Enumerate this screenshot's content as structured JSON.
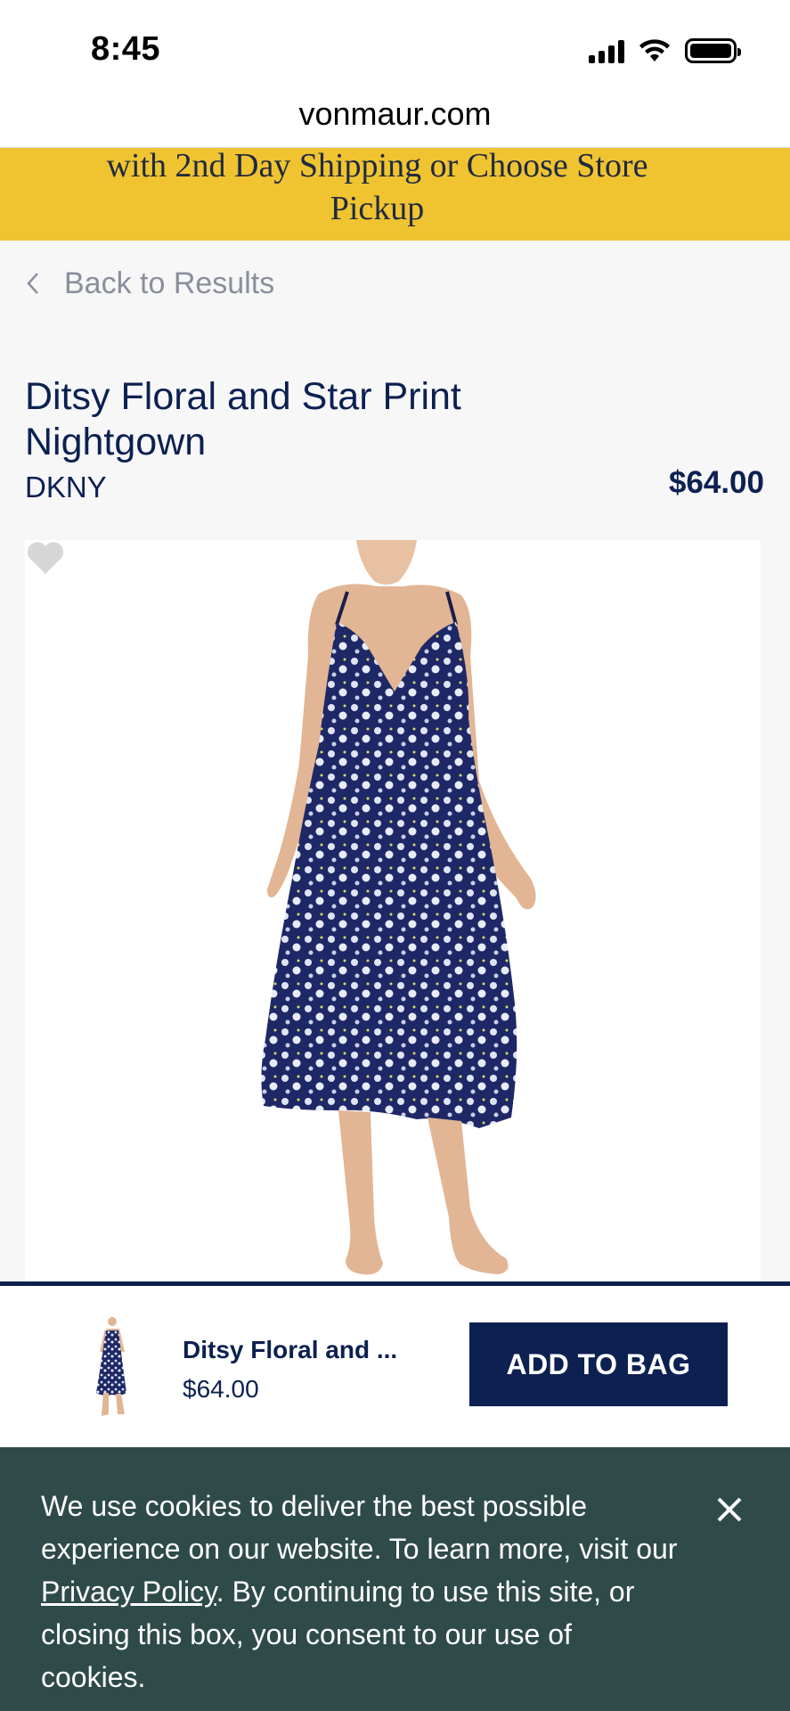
{
  "status_bar": {
    "time": "8:45"
  },
  "browser": {
    "url": "vonmaur.com"
  },
  "promo": {
    "line1": "with 2nd Day Shipping or Choose Store",
    "line2": "Pickup"
  },
  "nav": {
    "back_label": "Back to Results"
  },
  "product": {
    "title_line1": "Ditsy Floral and Star Print",
    "title_line2": "Nightgown",
    "brand": "DKNY",
    "price": "$64.00"
  },
  "sticky_bar": {
    "name": "Ditsy Floral and ...",
    "price": "$64.00",
    "button_label": "ADD TO BAG"
  },
  "cookie": {
    "text_before": "We use cookies to deliver the best possible experience on our website. To learn more, visit our ",
    "link_label": "Privacy Policy",
    "text_after": ". By continuing to use this site, or closing this box, you consent to our use of cookies."
  },
  "colors": {
    "navy": "#0c2051",
    "promo_yellow": "#f0c331",
    "cookie_green": "#2f4b49",
    "page_bg": "#f7f7f8"
  },
  "icons": {
    "back": "chevron-left-icon",
    "favorite": "heart-icon",
    "close": "close-icon"
  }
}
